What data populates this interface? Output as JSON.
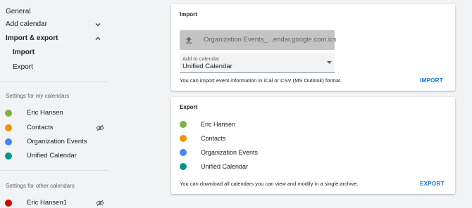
{
  "sidebar": {
    "general_label": "General",
    "add_calendar_label": "Add calendar",
    "import_export_label": "Import & export",
    "import_label": "Import",
    "export_label": "Export",
    "my_calendars_heading": "Settings for my calendars",
    "my_calendars": [
      {
        "label": "Eric Hansen",
        "color": "#7cb342",
        "hidden": false
      },
      {
        "label": "Contacts",
        "color": "#f09300",
        "hidden": true
      },
      {
        "label": "Organization Events",
        "color": "#4285f4",
        "hidden": false
      },
      {
        "label": "Unified Calendar",
        "color": "#009688",
        "hidden": false
      }
    ],
    "other_calendars_heading": "Settings for other calendars",
    "other_calendars": [
      {
        "label": "Eric Hansen1",
        "color": "#d50000",
        "hidden": true
      }
    ]
  },
  "import_card": {
    "title": "Import",
    "file_name": "Organization Events_...endar.google.com.ics",
    "select_label": "Add to calendar",
    "select_value": "Unified Calendar",
    "description": "You can import event information in iCal or CSV (MS Outlook) format.",
    "button_label": "IMPORT"
  },
  "export_card": {
    "title": "Export",
    "calendars": [
      {
        "label": "Eric Hansen",
        "color": "#7cb342"
      },
      {
        "label": "Contacts",
        "color": "#f09300"
      },
      {
        "label": "Organization Events",
        "color": "#4285f4"
      },
      {
        "label": "Unified Calendar",
        "color": "#009688"
      }
    ],
    "description": "You can download all calendars you can view and modify in a single archive.",
    "button_label": "EXPORT"
  },
  "colors": {
    "accent": "#1a73e8",
    "background": "#f1f3f4"
  },
  "icons": {
    "expand": "chevron-down-icon",
    "collapse": "chevron-up-icon",
    "hidden": "eye-off-icon",
    "upload": "upload-icon",
    "dropdown": "caret-down-icon"
  }
}
